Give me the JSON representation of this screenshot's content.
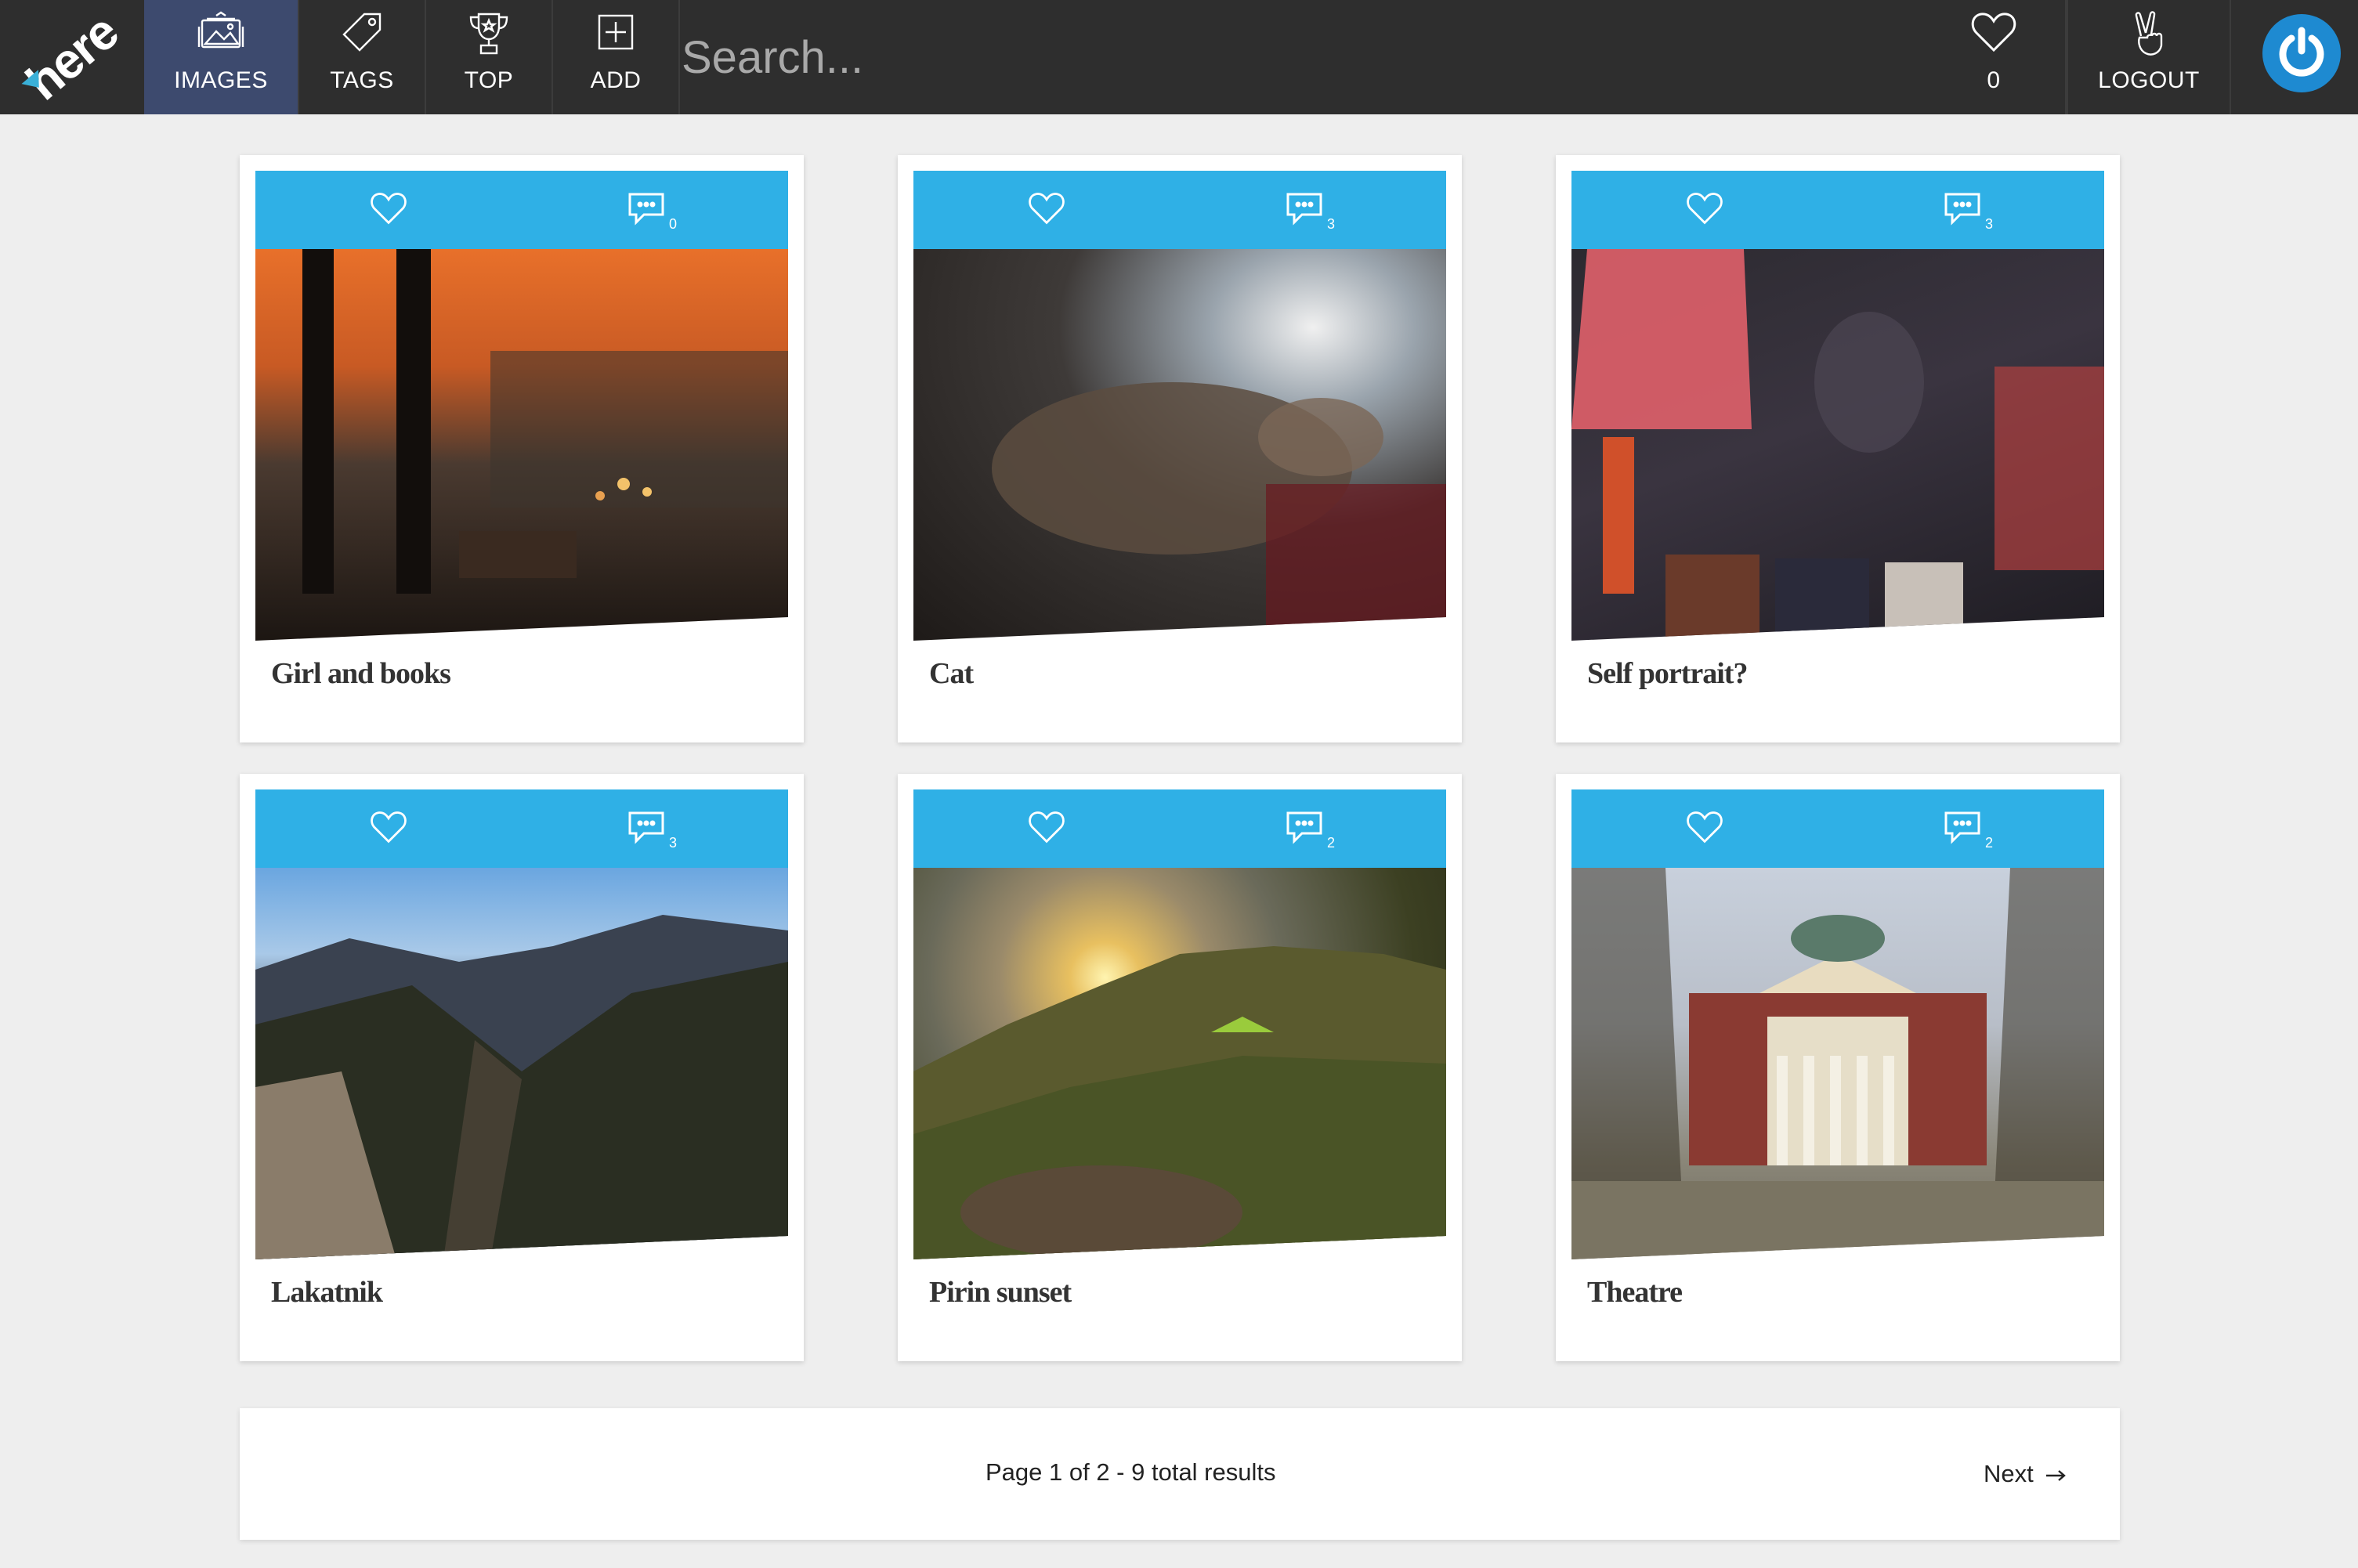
{
  "app": {
    "logo": "here"
  },
  "nav": {
    "items": [
      {
        "label": "IMAGES",
        "icon": "images-icon",
        "active": true
      },
      {
        "label": "TAGS",
        "icon": "tag-icon",
        "active": false
      },
      {
        "label": "TOP",
        "icon": "trophy-icon",
        "active": false
      },
      {
        "label": "ADD",
        "icon": "add-icon",
        "active": false
      }
    ],
    "search_placeholder": "Search...",
    "likes_count": "0",
    "logout_label": "LOGOUT"
  },
  "colors": {
    "topbar": "#2e2e2e",
    "active_nav": "#3d4a6e",
    "card_bar": "#2fb0e6",
    "power_button": "#1e8ad1"
  },
  "cards": [
    {
      "title": "Girl and books",
      "comments": "0"
    },
    {
      "title": "Cat",
      "comments": "3"
    },
    {
      "title": "Self portrait?",
      "comments": "3"
    },
    {
      "title": "Lakatnik",
      "comments": "3"
    },
    {
      "title": "Pirin sunset",
      "comments": "2"
    },
    {
      "title": "Theatre",
      "comments": "2"
    }
  ],
  "pagination": {
    "summary": "Page 1 of 2 - 9 total results",
    "next_label": "Next"
  }
}
